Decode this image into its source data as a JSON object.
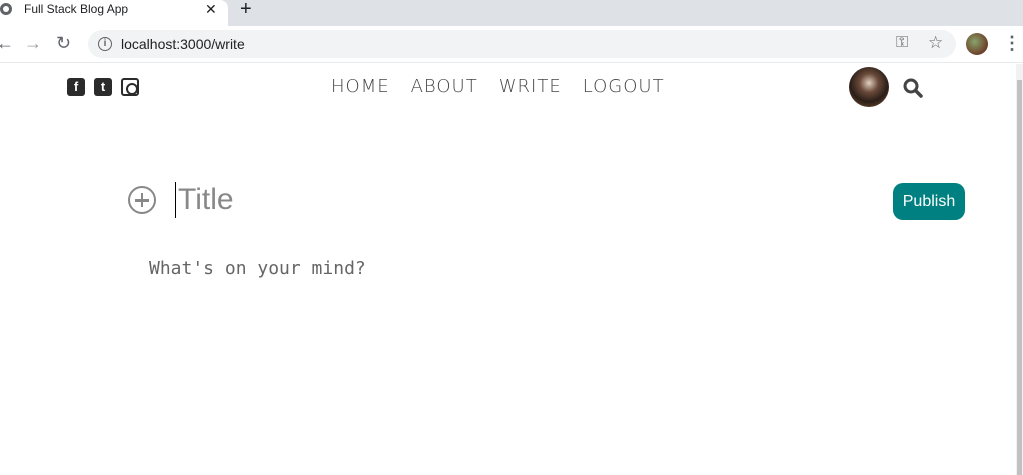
{
  "browser": {
    "tab_title": "Full Stack Blog App",
    "tab_close": "✕",
    "new_tab": "+",
    "url": "localhost:3000/write",
    "back_icon": "←",
    "forward_icon": "→",
    "reload_icon": "↻",
    "info_icon": "i",
    "key_icon": "⚿",
    "star_icon": "☆",
    "menu_icon": "⋮"
  },
  "topbar": {
    "social_icons": [
      "facebook-icon",
      "twitter-icon",
      "instagram-icon"
    ],
    "social_glyphs": {
      "facebook": "f",
      "twitter": "t"
    },
    "nav_items": [
      "HOME",
      "ABOUT",
      "WRITE",
      "LOGOUT"
    ]
  },
  "write": {
    "title_placeholder": "Title",
    "story_placeholder": "What's on your mind?",
    "publish_label": "Publish"
  },
  "colors": {
    "accent": "#008080",
    "nav_text": "#444444"
  }
}
